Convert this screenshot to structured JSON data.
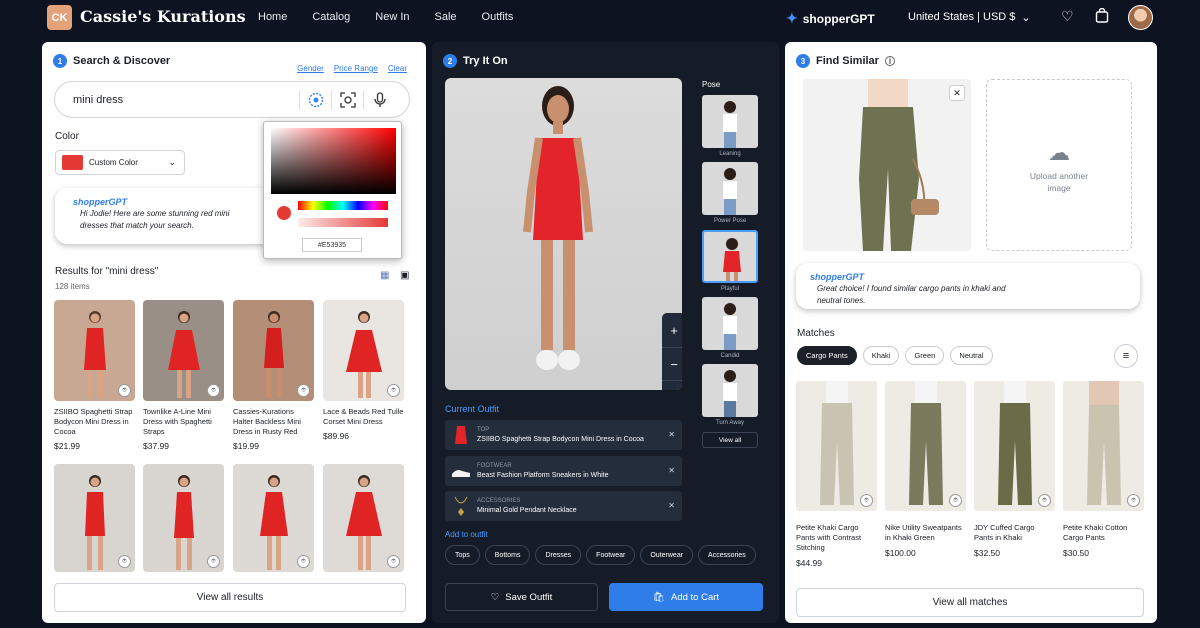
{
  "header": {
    "logo": "CK",
    "brand": "Cassie's Kurations",
    "nav": [
      "Home",
      "Catalog",
      "New In",
      "Sale",
      "Outfits"
    ],
    "assistant": "shopperGPT",
    "region": "United States | USD $"
  },
  "search_panel": {
    "step": "1",
    "title": "Search & Discover",
    "links": [
      "Gender",
      "Price Range",
      "Clear"
    ],
    "query": "mini dress",
    "color_label": "Color",
    "color_value": "Custom Color",
    "color_hex": "#E53935",
    "bubble_brand": "shopperGPT",
    "bubble_text": "Hi Jodie! Here are some stunning red mini dresses that match your search.",
    "results_title": "Results for \"mini dress\"",
    "results_count": "128 items",
    "products": [
      {
        "name": "ZSIIBO Spaghetti Strap Bodycon Mini Dress in Cocoa",
        "price": "$21.99"
      },
      {
        "name": "Townlike A-Line Mini Dress with Spaghetti Straps",
        "price": "$37.99"
      },
      {
        "name": "Cassies-Kurations Halter Backless Mini Dress in Rusty Red",
        "price": "$19.99"
      },
      {
        "name": "Lace & Beads Red Tulle Corset Mini Dress",
        "price": "$89.96"
      },
      {
        "name": "",
        "price": ""
      },
      {
        "name": "",
        "price": ""
      },
      {
        "name": "",
        "price": ""
      },
      {
        "name": "",
        "price": ""
      }
    ],
    "view_all": "View all results"
  },
  "tryon_panel": {
    "step": "2",
    "title": "Try It On",
    "pose_label": "Pose",
    "poses": [
      "Leaning",
      "Power Pose",
      "Playful",
      "Candid",
      "Turn Away"
    ],
    "view_all": "View all",
    "current_outfit": "Current Outfit",
    "outfit": [
      {
        "category": "TOP",
        "item": "ZSIIBO Spaghetti Strap Bodycon Mini Dress in Cocoa"
      },
      {
        "category": "FOOTWEAR",
        "item": "Beast Fashion Platform Sneakers in White"
      },
      {
        "category": "ACCESSORIES",
        "item": "Minimal Gold Pendant Necklace"
      }
    ],
    "add_label": "Add to outfit",
    "add_chips": [
      "Tops",
      "Bottoms",
      "Dresses",
      "Footwear",
      "Outerwear",
      "Accessories"
    ],
    "save": "Save Outfit",
    "cart": "Add to Cart"
  },
  "similar_panel": {
    "step": "3",
    "title": "Find Similar",
    "upload": "Upload another image",
    "bubble_brand": "shopperGPT",
    "bubble_text": "Great choice! I found similar cargo pants in khaki and neutral tones.",
    "matches_title": "Matches",
    "filters": [
      "Cargo Pants",
      "Khaki",
      "Green",
      "Neutral"
    ],
    "products": [
      {
        "name": "Petite Khaki Cargo Pants with Contrast Stitching",
        "price": "$44.99"
      },
      {
        "name": "Nike Utility Sweatpants in Khaki Green",
        "price": "$100.00"
      },
      {
        "name": "JDY Cuffed Cargo Pants in Khaki",
        "price": "$32.50"
      },
      {
        "name": "Petite Khaki Cotton Cargo Pants",
        "price": "$30.50"
      }
    ],
    "view_all": "View all matches"
  }
}
